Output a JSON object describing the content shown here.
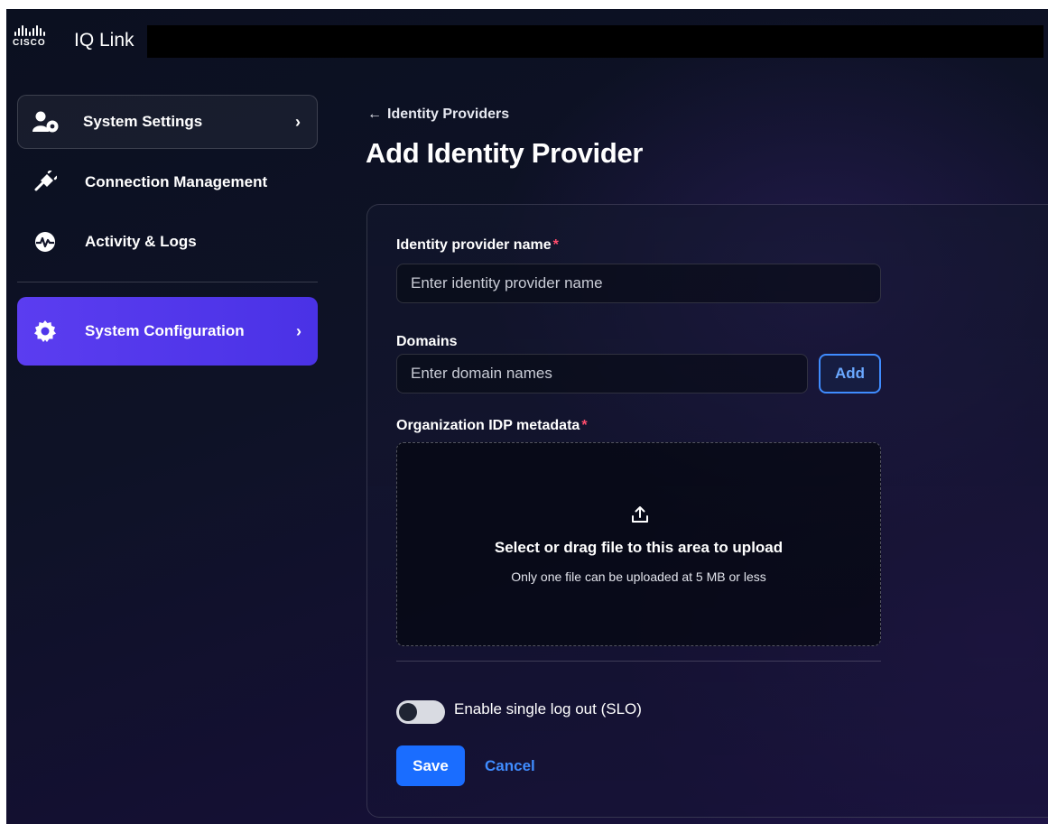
{
  "brand": {
    "logo_word": "CISCO",
    "app_title": "IQ Link"
  },
  "sidebar": {
    "items": [
      {
        "label": "System Settings",
        "icon": "user-gear-icon",
        "chevron": "›",
        "state": "outlined"
      },
      {
        "label": "Connection Management",
        "icon": "plug-icon"
      },
      {
        "label": "Activity & Logs",
        "icon": "activity-pulse-icon"
      },
      {
        "label": "System Configuration",
        "icon": "gear-icon",
        "chevron": "›",
        "state": "active"
      }
    ]
  },
  "header": {
    "back_link": "Identity Providers",
    "back_arrow": "←",
    "title": "Add Identity Provider"
  },
  "form": {
    "name_label": "Identity provider name",
    "required_mark": "*",
    "name_placeholder": "Enter identity provider name",
    "domains_label": "Domains",
    "domains_placeholder": "Enter domain names",
    "add_label": "Add",
    "metadata_label": "Organization IDP metadata",
    "upload_title": "Select or drag file to this area to upload",
    "upload_hint": "Only one file can be uploaded at 5 MB or less",
    "slo_label": "Enable single log out (SLO)",
    "slo_enabled": false,
    "save_label": "Save",
    "cancel_label": "Cancel"
  },
  "colors": {
    "accent": "#1a6dff",
    "active_nav": "#5b3df0",
    "required": "#ff4d6d",
    "link": "#3f8cff"
  }
}
